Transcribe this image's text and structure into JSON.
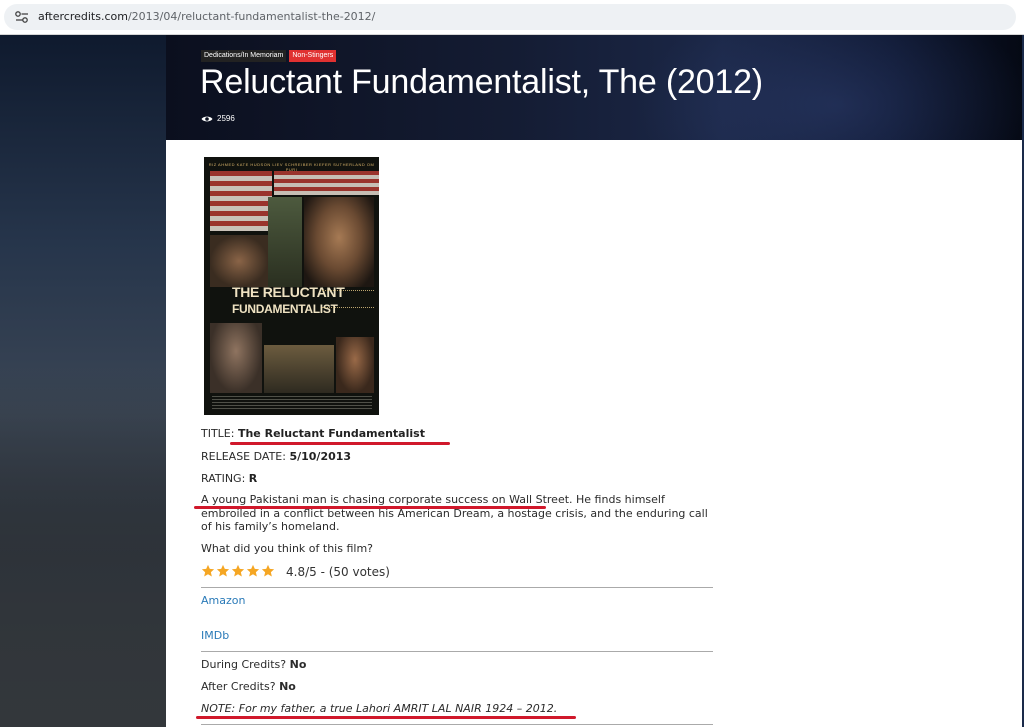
{
  "browser": {
    "url_host": "aftercredits.com",
    "url_path": "/2013/04/reluctant-fundamentalist-the-2012/"
  },
  "hero": {
    "tags": [
      "Dedications/In Memoriam",
      "Non-Stingers"
    ],
    "title": "Reluctant Fundamentalist, The (2012)",
    "view_count": "2596"
  },
  "poster": {
    "cast_line": "RIZ AHMED   KATE HUDSON   LIEV SCHREIBER   KIEFER SUTHERLAND   OM PURI",
    "title_line1": "THE RELUCTANT",
    "title_line2": "FUNDAMENTALIST"
  },
  "details": {
    "title_label": "TITLE:",
    "title_value": "The Reluctant Fundamentalist",
    "release_label": "RELEASE DATE:",
    "release_value": "5/10/2013",
    "rating_label": "RATING:",
    "rating_value": "R",
    "synopsis": "A young Pakistani man is chasing corporate success on Wall Street. He finds himself embroiled in a conflict between his American Dream, a hostage crisis, and the enduring call of his family’s homeland."
  },
  "vote": {
    "prompt": "What did you think of this film?",
    "stars_filled": 5,
    "rating_text": "4.8/5 - (50 votes)"
  },
  "links": {
    "amazon": "Amazon",
    "imdb": "IMDb"
  },
  "credits": {
    "during_label": "During Credits?",
    "during_value": "No",
    "after_label": "After Credits?",
    "after_value": "No",
    "note": "NOTE: For my father, a true Lahori AMRIT LAL NAIR 1924 – 2012."
  },
  "colors": {
    "accent_red": "#d0182b",
    "link_blue": "#2a7ab8",
    "star_gold": "#f5a623"
  }
}
